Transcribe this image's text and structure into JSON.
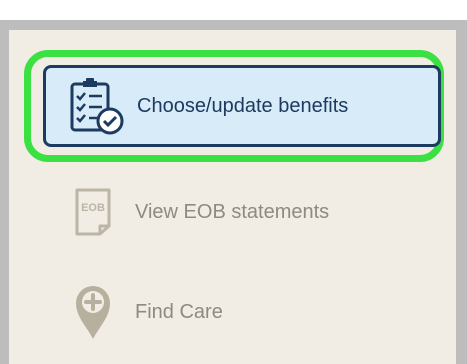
{
  "menu": {
    "items": [
      {
        "label": "Choose/update benefits",
        "icon": "clipboard-check-icon",
        "selected": true
      },
      {
        "label": "View EOB statements",
        "icon": "eob-document-icon",
        "icon_text": "EOB",
        "selected": false
      },
      {
        "label": "Find Care",
        "icon": "location-pin-plus-icon",
        "selected": false
      }
    ]
  },
  "colors": {
    "highlight_outline": "#3be043",
    "active_background": "#d8ebf8",
    "active_border": "#1d3a60",
    "active_text": "#1d3a60",
    "muted_text": "#8f8a80",
    "panel_background": "#f1ede4",
    "frame_background": "#bdbdbd"
  }
}
